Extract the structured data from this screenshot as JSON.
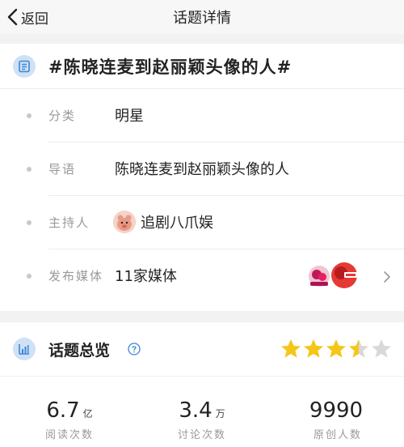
{
  "nav": {
    "back_label": "返回",
    "title": "话题详情"
  },
  "topic": {
    "title": "#陈晓连麦到赵丽颖头像的人#"
  },
  "details": {
    "category": {
      "label": "分类",
      "value": "明星"
    },
    "guide": {
      "label": "导语",
      "value": "陈晓连麦到赵丽颖头像的人"
    },
    "host": {
      "label": "主持人",
      "value": "追剧八爪娱"
    },
    "media": {
      "label": "发布媒体",
      "value": "11家媒体"
    }
  },
  "overview": {
    "title": "话题总览",
    "rating": 3.5,
    "rating_max": 5,
    "colors": {
      "star_on": "#f5c518",
      "star_off": "#d9d9d9"
    },
    "stats": [
      {
        "value": "6.7",
        "unit": "亿",
        "label": "阅读次数"
      },
      {
        "value": "3.4",
        "unit": "万",
        "label": "讨论次数"
      },
      {
        "value": "9990",
        "unit": "",
        "label": "原创人数"
      }
    ]
  },
  "icons": [
    "back-chevron-icon",
    "topic-list-icon",
    "avatar",
    "media-logo",
    "chevron-right-icon",
    "chart-icon",
    "help-icon",
    "star-icon"
  ]
}
